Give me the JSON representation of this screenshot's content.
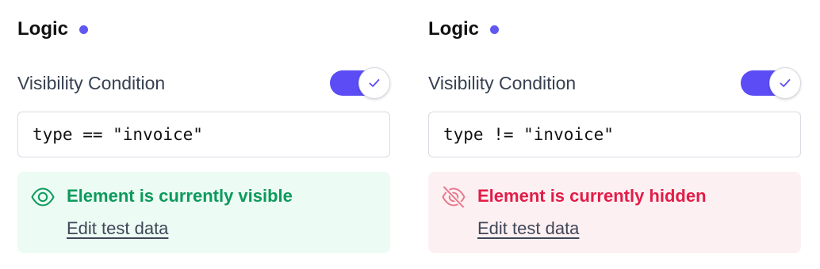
{
  "panels": [
    {
      "title": "Logic",
      "field_label": "Visibility Condition",
      "toggle_on": true,
      "expression": "type == \"invoice\"",
      "status": "visible",
      "status_text": "Element is currently visible",
      "status_icon": "eye-icon",
      "edit_link": "Edit test data"
    },
    {
      "title": "Logic",
      "field_label": "Visibility Condition",
      "toggle_on": true,
      "expression": "type != \"invoice\"",
      "status": "hidden",
      "status_text": "Element is currently hidden",
      "status_icon": "eye-off-icon",
      "edit_link": "Edit test data"
    }
  ],
  "colors": {
    "accent": "#5b4cf5",
    "indicator_dot": "#6058f0",
    "visible_text": "#0c9a5c",
    "visible_bg": "#ecfbf3",
    "hidden_text": "#e11d48",
    "hidden_bg": "#fdf0f2"
  }
}
